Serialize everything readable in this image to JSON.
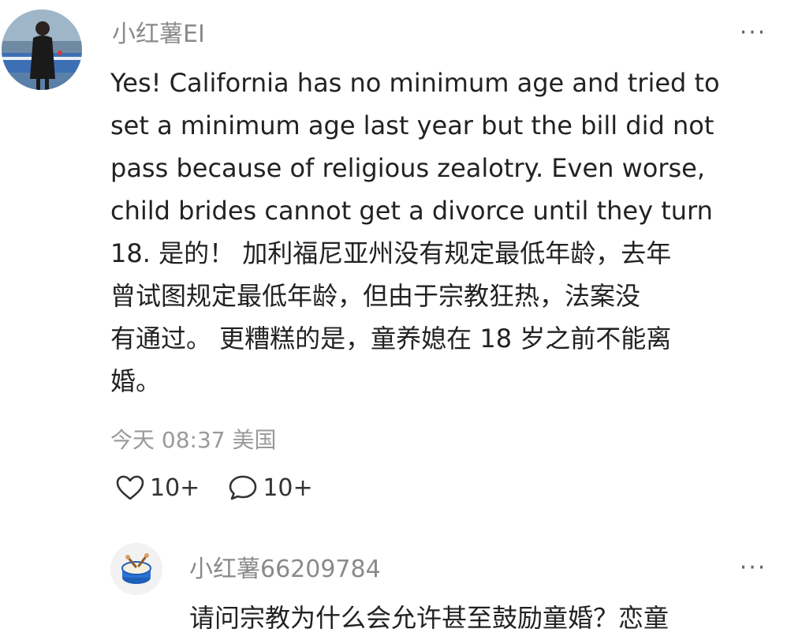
{
  "comment": {
    "username": "小红薯EI",
    "lines": [
      "Yes! California has no minimum age and tried to",
      "set a minimum age last year but the bill did not",
      "pass because of religious zealotry. Even worse,",
      "child brides cannot get a divorce until they turn",
      "18. 是的！ 加利福尼亚州没有规定最低年龄，去年",
      "曾试图规定最低年龄，但由于宗教狂热，法案没",
      "有通过。 更糟糕的是，童养媳在 18 岁之前不能离",
      "婚。"
    ],
    "timestamp": "今天 08:37 美国",
    "like_count": "10+",
    "comment_count": "10+",
    "more": "···"
  },
  "reply": {
    "username": "小红薯66209784",
    "text": "请问宗教为什么会允许甚至鼓励童婚？恋童",
    "more": "···"
  },
  "icons": {
    "like": "heart-outline-icon",
    "comment": "speech-bubble-icon",
    "more": "ellipsis-icon"
  },
  "colors": {
    "username": "#8a8a8a",
    "body_text": "#222222",
    "meta_text": "#9a9a9a"
  }
}
